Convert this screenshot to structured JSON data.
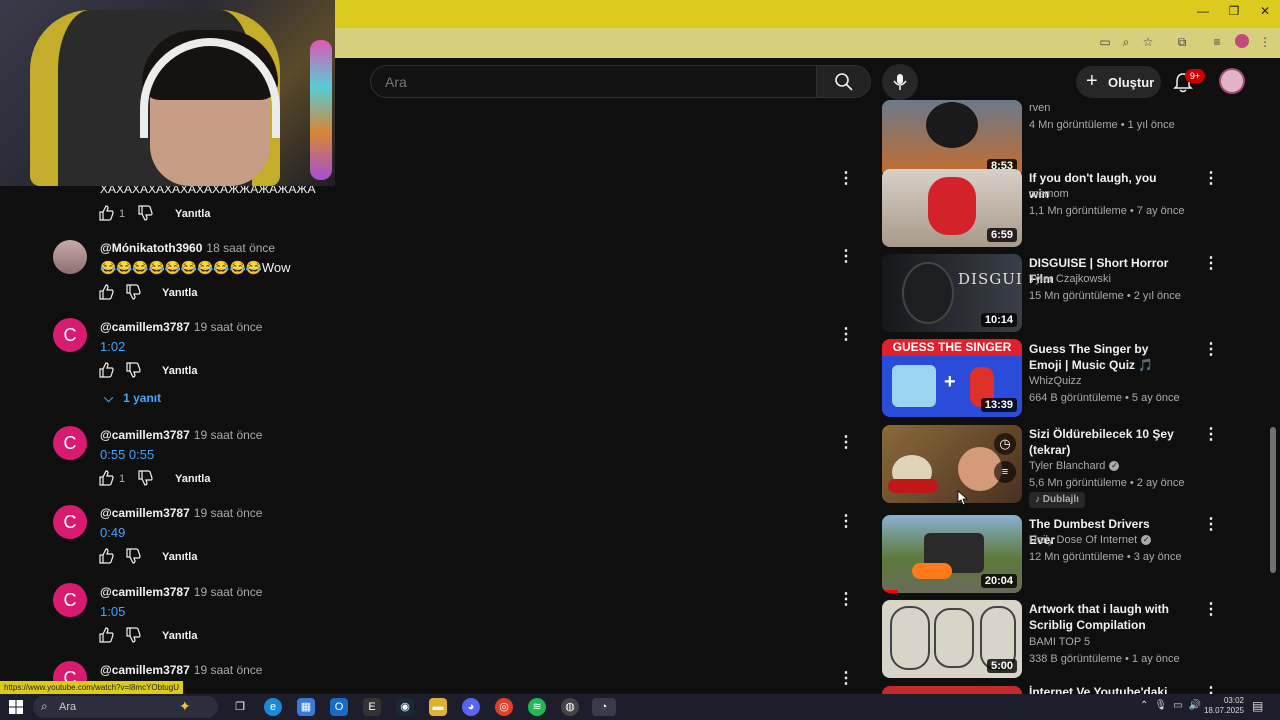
{
  "browser": {
    "window_controls": [
      "—",
      "❐",
      "✕"
    ],
    "status_url": "https://www.youtube.com/watch?v=l8mcYObtugU"
  },
  "youtube": {
    "search_placeholder": "Ara",
    "create_label": "Oluştur",
    "notifications_badge": "9+"
  },
  "comments": {
    "stub_text": "ХАХАХАХАХАХАХАХАЖЖАЖАЖАЖА",
    "stub_likes": "1",
    "reply_label": "Yanıtla",
    "items": [
      {
        "author": "@Mónikatoth3960",
        "time": "18 saat önce",
        "text": "😂😂😂😂😂😂😂😂😂😂Wow",
        "likes": ""
      },
      {
        "author": "@camillem3787",
        "time": "19 saat önce",
        "text": "1:02",
        "likes": ""
      },
      {
        "author": "@camillem3787",
        "time": "19 saat önce",
        "text": "0:55 0:55",
        "likes": "1"
      },
      {
        "author": "@camillem3787",
        "time": "19 saat önce",
        "text": "0:49",
        "likes": ""
      },
      {
        "author": "@camillem3787",
        "time": "19 saat önce",
        "text": "1:05",
        "likes": ""
      },
      {
        "author": "@camillem3787",
        "time": "19 saat önce",
        "text": "",
        "likes": ""
      }
    ],
    "replies_toggle": "1 yanıt",
    "avatar_letter": "C"
  },
  "sidebar": {
    "videos": [
      {
        "title": "",
        "channel": "rven",
        "meta": "4 Mn görüntüleme • 1 yıl önce",
        "duration": "8:53",
        "thumb": "#c96b2a"
      },
      {
        "title": "If you don't laugh, you win",
        "channel": "memom",
        "meta": "1,1 Mn görüntüleme • 7 ay önce",
        "duration": "6:59",
        "thumb": "#c8bfb6"
      },
      {
        "title": "DISGUISE | Short Horror Film",
        "channel": "Tyler Czajkowski",
        "meta": "15 Mn görüntüleme • 2 yıl önce",
        "duration": "10:14",
        "thumb": "#2a2d33"
      },
      {
        "title": "Guess The Singer by Emoji | Music Quiz 🎵",
        "channel": "WhizQuizz",
        "meta": "664 B görüntüleme • 5 ay önce",
        "duration": "13:39",
        "thumb": "#2a4cd8"
      },
      {
        "title": "Sizi Öldürebilecek 10 Şey (tekrar)",
        "channel": "Tyler Blanchard",
        "meta": "5,6 Mn görüntüleme • 2 ay önce",
        "duration": "",
        "thumb": "#6b4a2a",
        "badge": "Dublajlı"
      },
      {
        "title": "The Dumbest Drivers Ever",
        "channel": "Daily Dose Of Internet",
        "meta": "12 Mn görüntüleme • 3 ay önce",
        "duration": "20:04",
        "thumb": "#5d7a3a"
      },
      {
        "title": "Artwork that i laugh with Scriblig Compilation",
        "channel": "BAMI TOP 5",
        "meta": "338 B görüntüleme • 1 ay önce",
        "duration": "5:00",
        "thumb": "#d8d4c8"
      },
      {
        "title": "İnternet Ve Youtube'daki En",
        "channel": "",
        "meta": "",
        "duration": "",
        "thumb": "#c42a2a"
      }
    ]
  },
  "taskbar": {
    "search_label": "Ara",
    "time": "03:02",
    "date": "18.07.2025"
  },
  "colors": {
    "browser_accent": "#dccb1c",
    "link": "#3ea6ff",
    "avatar": "#d81b71"
  }
}
